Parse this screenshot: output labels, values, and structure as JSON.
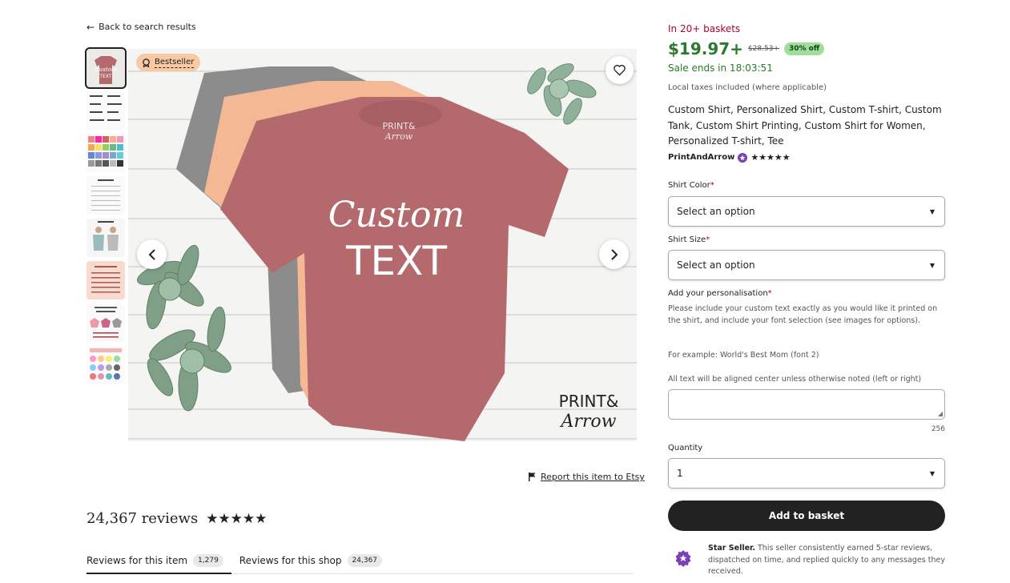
{
  "nav": {
    "back_label": "Back to search results"
  },
  "gallery": {
    "bestseller_label": "Bestseller",
    "thumbnail_count": 8,
    "watermark_line1": "PRINT&",
    "watermark_line2": "Arrow",
    "shirt_line1": "Custom",
    "shirt_line2": "TEXT",
    "collar_line1": "PRINT&",
    "collar_line2": "Arrow"
  },
  "report_label": "Report this item to Etsy",
  "reviews": {
    "count_label": "24,367 reviews",
    "rating_stars": 5,
    "tabs": [
      {
        "label": "Reviews for this item",
        "count": "1,279"
      },
      {
        "label": "Reviews for this shop",
        "count": "24,367"
      }
    ]
  },
  "listing": {
    "baskets": "In 20+ baskets",
    "price": "$19.97+",
    "original_price": "$28.53+",
    "discount": "30% off",
    "sale_ends": "Sale ends in 18:03:51",
    "taxes": "Local taxes included (where applicable)",
    "title": "Custom Shirt, Personalized Shirt, Custom T-shirt, Custom Tank, Custom Shirt Printing, Custom Shirt for Women, Personalized T-shirt, Tee",
    "shop_name": "PrintAndArrow",
    "shop_rating_stars": 5
  },
  "options": {
    "color_label": "Shirt Color",
    "color_value": "Select an option",
    "size_label": "Shirt Size",
    "size_value": "Select an option",
    "required_mark": "*"
  },
  "personalisation": {
    "label": "Add your personalisation",
    "help1": "Please include your custom text exactly as you would like it printed on the shirt, and include your font selection (see images for options).",
    "help2": "For example: World's Best Mom (font 2)",
    "help3": "All text will be aligned center unless otherwise noted (left or right)",
    "char_count": "256"
  },
  "quantity": {
    "label": "Quantity",
    "value": "1"
  },
  "add_to_basket": "Add to basket",
  "star_seller": {
    "title": "Star Seller.",
    "text": " This seller consistently earned 5-star reviews, dispatched on time, and replied quickly to any messages they received."
  },
  "colors": {
    "price_green": "#2b7a2e",
    "alert_red": "#b3002f",
    "discount_bg": "#9ee09a",
    "bestseller_bg": "#f9c9a3",
    "shirt_mauve": "#b46a6d",
    "shirt_peach": "#f5b895",
    "shirt_grey": "#8a8a8a",
    "star_seller_purple": "#7b3fb8"
  }
}
